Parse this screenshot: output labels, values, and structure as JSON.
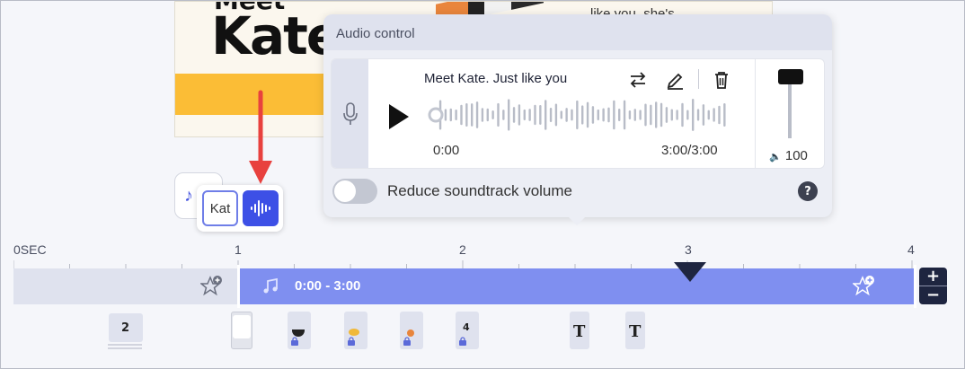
{
  "slide": {
    "meet_text": "Meet",
    "heading": "Kate",
    "body_text": "like you, she's"
  },
  "chips": {
    "kat_label": "Kat"
  },
  "popup": {
    "title": "Audio control",
    "track_title": "Meet Kate. Just like you",
    "time_start": "0:00",
    "time_end": "3:00/3:00",
    "volume": "100",
    "volume_level": 100,
    "toggle_label": "Reduce soundtrack volume",
    "toggle_on": false,
    "help": "?"
  },
  "timeline": {
    "ruler_labels": [
      "0SEC",
      "1",
      "2",
      "3",
      "4"
    ],
    "audio_range": "0:00 - 3:00",
    "zoom_in": "+",
    "zoom_out": "−",
    "markers": [
      "2",
      "4"
    ],
    "text_markers": [
      "T",
      "T"
    ]
  },
  "colors": {
    "accent": "#3d50e6",
    "audio_track": "#7f8ff0",
    "annotation": "#e8413e",
    "dark": "#1e2540"
  }
}
